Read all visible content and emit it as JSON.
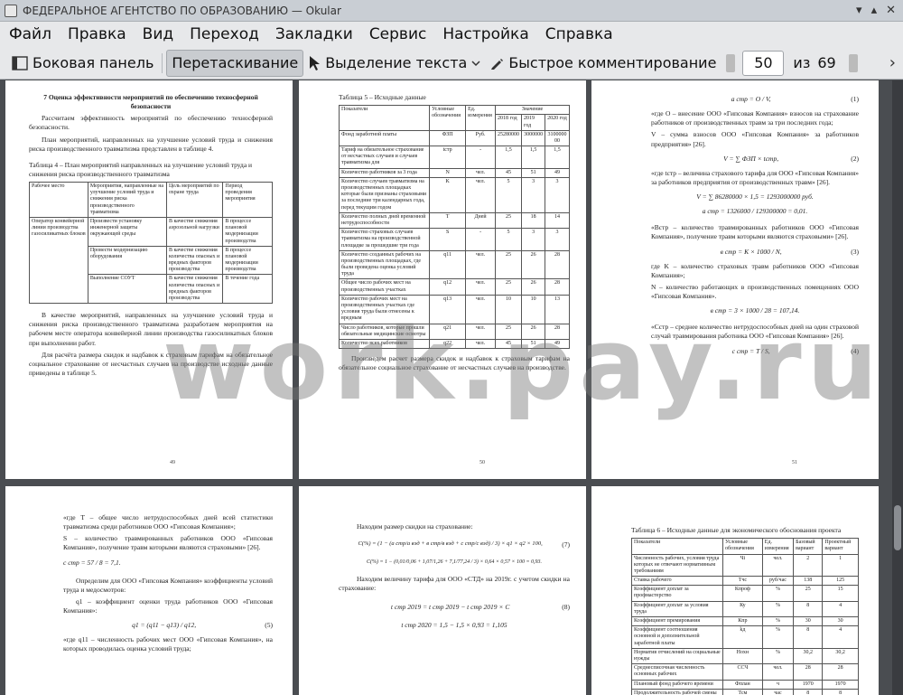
{
  "window": {
    "title": "ФЕДЕРАЛЬНОЕ АГЕНТСТВО ПО ОБРАЗОВАНИЮ  — Okular"
  },
  "menu": [
    "Файл",
    "Правка",
    "Вид",
    "Переход",
    "Закладки",
    "Сервис",
    "Настройка",
    "Справка"
  ],
  "toolbar": {
    "sidebar": "Боковая панель",
    "drag": "Перетаскивание",
    "select_text": "Выделение текста",
    "quick_annot": "Быстрое комментирование",
    "page_value": "50",
    "of": "из",
    "total": "69"
  },
  "watermark": "work.pay.ru",
  "p49": {
    "heading": "7 Оценка эффективности мероприятий по обеспечению техносферной безопасности",
    "para1": "Рассчитаем эффективность мероприятий по обеспечению техносферной безопасности.",
    "para2": "План мероприятий, направленных на улучшение условий труда и снижения риска производственного травматизма представлен в таблице 4.",
    "table_caption": "Таблица 4 – План мероприятий направленных на улучшение условий труда и снижения риска производственного травматизма",
    "headers": [
      "Рабочее место",
      "Мероприятия, направленные на улучшение условий труда и снижения риска производственного травматизма",
      "Цель мероприятий по охране труда",
      "Период проведения мероприятия"
    ],
    "rows": [
      [
        "Оператор конвейерной линии производства газосиликатных блоков",
        "Произвести установку инженерной защиты окружающей среды",
        "В качестве снижения аэрозольной нагрузки",
        "В процессе плановой модернизации производства"
      ],
      [
        "",
        "Провести модернизацию оборудования",
        "В качестве снижения количества опасных и вредных факторов производства",
        "В процессе плановой модернизации производства"
      ],
      [
        "",
        "Выполнение СОУТ",
        "В качестве снижения количества опасных и вредных факторов производства",
        "В течение года"
      ]
    ],
    "para3": "В качестве мероприятий, направленных на улучшение условий труда и снижения риска производственного травматизма разработаем мероприятия на рабочем месте оператора конвейерной линии производства газосиликатных блоков при выполнении работ.",
    "para4": "Для расчёта размера скидок и надбавок к страховым тарифам на обязательное социальное страхование от несчастных случаев на производстве исходные данные приведены в таблице 5.",
    "num": "49"
  },
  "p50": {
    "caption": "Таблица 5 – Исходные данные",
    "h_indicator": "Показатели",
    "h_symbol": "Условные обозначения",
    "h_unit": "Ед. измерения",
    "h_value": "Значение",
    "years": [
      "2018 год",
      "2019 год",
      "2020 год"
    ],
    "rows": [
      [
        "Фонд заработной платы",
        "ФЗП",
        "Руб.",
        "25280000",
        "3000000",
        "3100000 00"
      ],
      [
        "Тариф на обязательное страхование от несчастных случаев и случаев травматизма для",
        "tстр",
        "-",
        "1,5",
        "1,5",
        "1,5"
      ],
      [
        "Количество работников за 3 года",
        "N",
        "чел.",
        "45",
        "51",
        "49"
      ],
      [
        "Количество случаев травматизма на производственных площадках которые были признаны страховыми за последние три календарных года, перед текущим годом",
        "K",
        "чел.",
        "5",
        "3",
        "3"
      ],
      [
        "Количество полных дней временной нетрудоспособности",
        "T",
        "Дней",
        "25",
        "18",
        "14"
      ],
      [
        "Количество страховых случаев травматизма на производственной площадке за прошедшие три года",
        "S",
        "-",
        "5",
        "3",
        "3"
      ],
      [
        "Количество созданных рабочих на производственных площадках, где были проведена оценка условий труда",
        "q11",
        "чел.",
        "25",
        "26",
        "28"
      ],
      [
        "Общее число рабочих мест на производственных участках",
        "q12",
        "чел.",
        "25",
        "26",
        "28"
      ],
      [
        "Количество рабочих мест на производственных участках где условия труда были отнесены к вредным",
        "q13",
        "чел.",
        "10",
        "10",
        "13"
      ],
      [
        "Число работников, которые прошли обязательные медицинские осмотры",
        "q21",
        "чел.",
        "25",
        "26",
        "28"
      ],
      [
        "Количество всех работников",
        "q22",
        "чел.",
        "45",
        "51",
        "49"
      ]
    ],
    "para": "Произведем расчет размера скидок и надбавок к страховым тарифам на обязательное социальное страхование от несчастных случаев на производстве.",
    "num": "50"
  },
  "p51": {
    "f1": "a стр = O / V,",
    "f1n": "(1)",
    "t1": "«где O – внесение ООО «Гипсовая Компания» взносов на страхование работников от производственных травм за три последних года;",
    "t2": "V – сумма взносов ООО «Гипсовая Компания» за работников предприятия» [26].",
    "f2": "V = ∑ ФЗП × tстр,",
    "f2n": "(2)",
    "t3": "«где tстр – величина страхового тарифа для ООО «Гипсовая Компания» за работников предприятия от производственных травм» [26].",
    "f3a": "V = ∑ 86280000 × 1,5 = 1293000000 руб.",
    "f3b": "a стр = 1326000 / 129300000 = 0,01.",
    "t4": "«Bстр – количество травмированных работников ООО «Гипсовая Компания», получение травм которыми являются страховыми» [26].",
    "f4": "в стр = K × 1000 / N,",
    "f4n": "(3)",
    "t5": "где K – количество страховых травм работников ООО «Гипсовая Компания»;",
    "t6": "N – количество работающих в производственных помещениях ООО «Гипсовая Компания».",
    "f5": "в стр = 3 × 1000 / 28 = 107,14.",
    "t7": "«Cстр – среднее количество нетрудоспособных дней на один страховой случай травмирования работника ООО «Гипсовая Компания» [26].",
    "f6": "c стр = T / S,",
    "f6n": "(4)",
    "num": "51"
  },
  "p52": {
    "t1": "«где T – общее число нетрудоспособных дней всей статистики травматизма среди работников ООО «Гипсовая Компания»;",
    "t2": "S – количество травмированных работников ООО «Гипсовая Компания», получение травм которыми являются страховыми» [26].",
    "f1": "c стр = 57 / 8 = 7,1.",
    "t3": "Определим для ООО «Гипсовая Компания» коэффициенты условий труда и медосмотров:",
    "t4": "q1 – коэффициент оценки труда работников ООО «Гипсовая Компания»:",
    "f2": "q1 = (q11 − q13) / q12,",
    "f2n": "(5)",
    "t5": "«где q11 – численность рабочих мест ООО «Гипсовая Компания», на которых проводилась оценка условий труда;"
  },
  "p53": {
    "t1": "Находим размер скидки на страхование:",
    "f1": "C(%) = (1 − (a стр/a вэд + в стр/в вэд + c стр/c вэд) / 3) × q1 × q2 × 100,",
    "f1n": "(7)",
    "f2": "C(%) = 1 − (0,01/0,06 + 1,07/1,26 + 7,1/77,24 / 3) × 0,64 × 0,57 × 100 = 0,93.",
    "t2": "Находим величину тарифа для ООО «СТД» на 2019г. с учетом скидки на страхование:",
    "f3": "t стр 2019 = t стр 2019 − t стр 2019 × C",
    "f3n": "(8)",
    "f4": "t стр 2020 = 1,5 − 1,5 × 0,93 = 1,105"
  },
  "p54": {
    "caption": "Таблица 6 – Исходные данные для экономического обоснования проекта",
    "headers": [
      "Показатели",
      "Условные обозначения",
      "Ед. измерения",
      "Базовый вариант",
      "Проектный вариант"
    ],
    "rows": [
      [
        "Численность рабочих, условия труда которых не отвечают нормативным требованиям",
        "Чi",
        "чел.",
        "2",
        "1"
      ],
      [
        "Ставка рабочего",
        "Тчс",
        "руб/час",
        "138",
        "125"
      ],
      [
        "Коэффициент доплат за профмастерство",
        "Кпроф",
        "%",
        "25",
        "15"
      ],
      [
        "Коэффициент доплат за условия труда",
        "Ку",
        "%",
        "8",
        "4"
      ],
      [
        "Коэффициент премирования",
        "Кпр",
        "%",
        "30",
        "30"
      ],
      [
        "Коэффициент соотношения основной и дополнительной заработной платы",
        "kд",
        "%",
        "8",
        "4"
      ],
      [
        "Норматив отчислений на социальные нужды",
        "Нохн",
        "%",
        "30,2",
        "30,2"
      ],
      [
        "Среднесписочная численность основных рабочих",
        "ССЧ",
        "чел.",
        "28",
        "28"
      ],
      [
        "Плановый фонд рабочего времени",
        "Фплан",
        "ч",
        "1970",
        "1970"
      ],
      [
        "Продолжительность рабочей смены",
        "Тсм",
        "час",
        "8",
        "8"
      ]
    ]
  }
}
